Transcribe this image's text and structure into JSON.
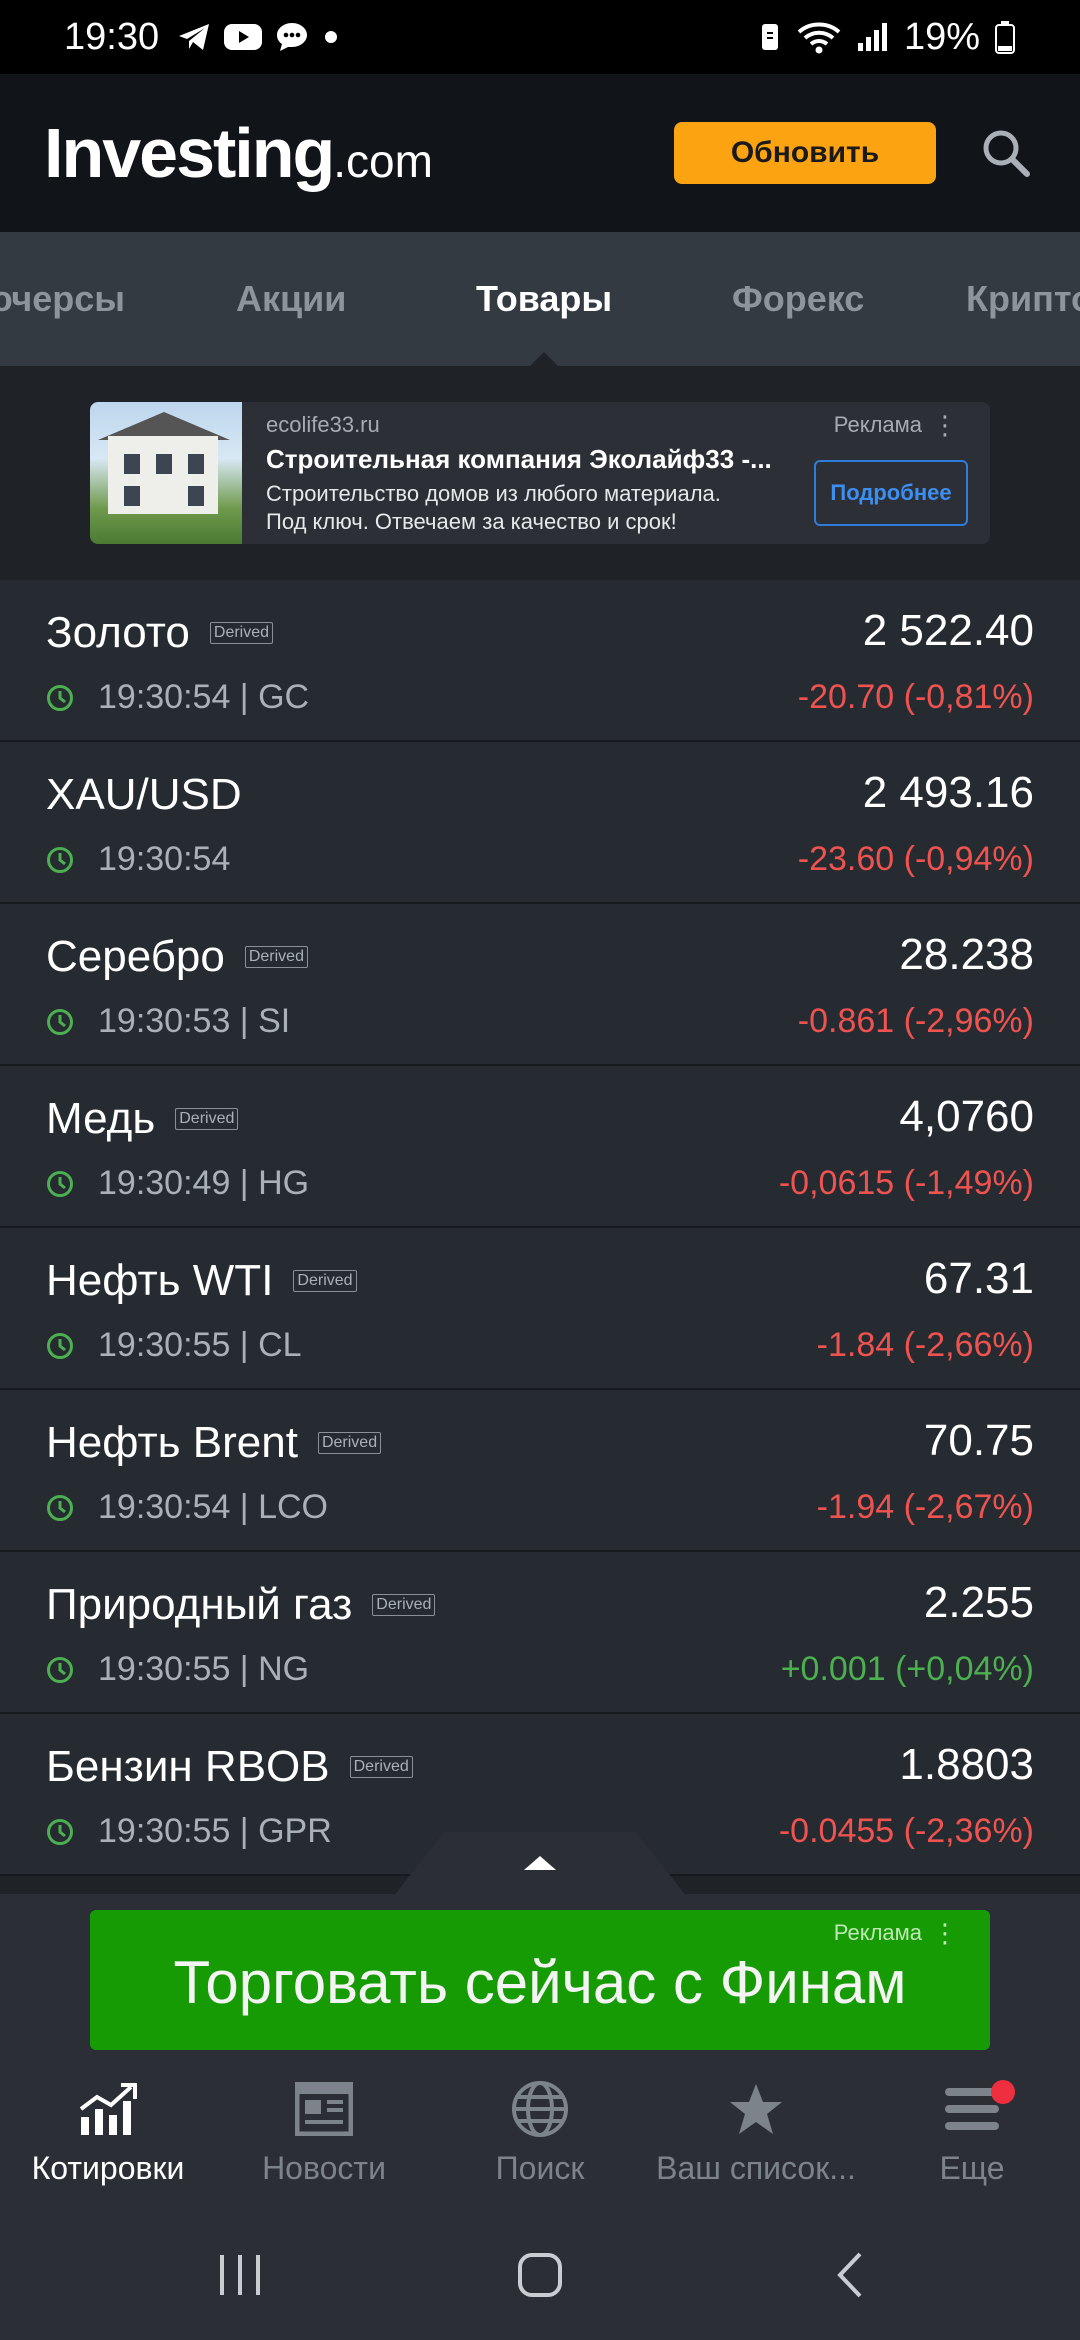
{
  "status_bar": {
    "time": "19:30",
    "battery": "19%"
  },
  "header": {
    "logo_main": "Investing",
    "logo_suffix": ".com",
    "update_label": "Обновить"
  },
  "tabs": [
    {
      "label": "Фьючерсы",
      "display": "ючерсы",
      "active": false
    },
    {
      "label": "Акции",
      "active": false
    },
    {
      "label": "Товары",
      "active": true
    },
    {
      "label": "Форекс",
      "active": false
    },
    {
      "label": "Криптовалюты",
      "display": "Крипто",
      "active": false
    }
  ],
  "top_ad": {
    "domain": "ecolife33.ru",
    "label": "Реклама",
    "title": "Строительная компания Эколайф33 -...",
    "desc_line1": "Строительство домов из любого материала.",
    "desc_line2": "Под ключ. Отвечаем за качество и срок!",
    "button": "Подробнее"
  },
  "quotes": [
    {
      "name": "Золото",
      "derived": true,
      "derived_label": "Derived",
      "meta": "19:30:54 | GC",
      "price": "2 522.40",
      "change": "-20.70 (-0,81%)",
      "direction": "down"
    },
    {
      "name": "XAU/USD",
      "derived": false,
      "derived_label": "",
      "meta": "19:30:54",
      "price": "2 493.16",
      "change": "-23.60 (-0,94%)",
      "direction": "down"
    },
    {
      "name": "Серебро",
      "derived": true,
      "derived_label": "Derived",
      "meta": "19:30:53 | SI",
      "price": "28.238",
      "change": "-0.861 (-2,96%)",
      "direction": "down"
    },
    {
      "name": "Медь",
      "derived": true,
      "derived_label": "Derived",
      "meta": "19:30:49 | HG",
      "price": "4,0760",
      "change": "-0,0615 (-1,49%)",
      "direction": "down"
    },
    {
      "name": "Нефть WTI",
      "derived": true,
      "derived_label": "Derived",
      "meta": "19:30:55 | CL",
      "price": "67.31",
      "change": "-1.84 (-2,66%)",
      "direction": "down"
    },
    {
      "name": "Нефть Brent",
      "derived": true,
      "derived_label": "Derived",
      "meta": "19:30:54 | LCO",
      "price": "70.75",
      "change": "-1.94 (-2,67%)",
      "direction": "down"
    },
    {
      "name": "Природный газ",
      "derived": true,
      "derived_label": "Derived",
      "meta": "19:30:55 | NG",
      "price": "2.255",
      "change": "+0.001 (+0,04%)",
      "direction": "up"
    },
    {
      "name": "Бензин RBOB",
      "derived": true,
      "derived_label": "Derived",
      "meta": "19:30:55 | GPR",
      "price": "1.8803",
      "change": "-0.0455 (-2,36%)",
      "direction": "down"
    }
  ],
  "bottom_ad": {
    "text": "Торговать сейчас с Финам",
    "label": "Реклама"
  },
  "bottom_nav": [
    {
      "label": "Котировки",
      "icon": "chart-icon",
      "active": true
    },
    {
      "label": "Новости",
      "icon": "newspaper-icon",
      "active": false
    },
    {
      "label": "Поиск",
      "icon": "globe-icon",
      "active": false
    },
    {
      "label": "Ваш список...",
      "icon": "star-icon",
      "active": false
    },
    {
      "label": "Еще",
      "icon": "menu-icon",
      "active": false
    }
  ],
  "colors": {
    "accent": "#fca311",
    "negative": "#ef5350",
    "positive": "#4caf50",
    "ad_green": "#169b05"
  }
}
